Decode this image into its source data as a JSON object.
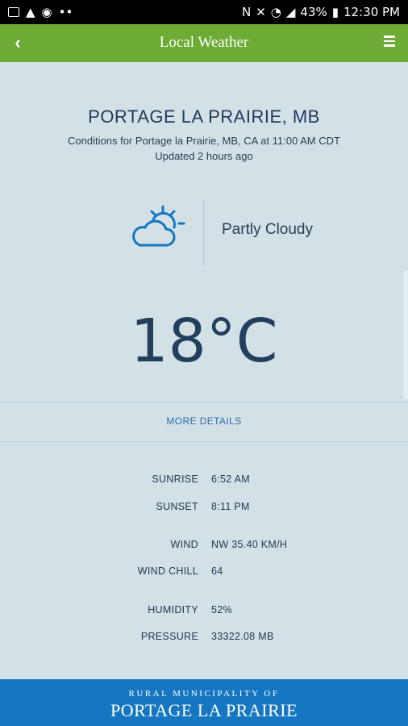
{
  "status_bar": {
    "battery": "43%",
    "time": "12:30 PM",
    "left_icons": [
      "image-icon",
      "drive-icon",
      "sync-icon",
      "more-icon"
    ],
    "right_icons": [
      "nfc-icon",
      "mute-icon",
      "wifi-icon",
      "signal-icon",
      "battery-icon"
    ]
  },
  "app_bar": {
    "title": "Local Weather",
    "color": "#6cab34"
  },
  "location": {
    "name": "PORTAGE LA PRAIRIE, MB",
    "conditions_for": "Conditions for Portage la Prairie, MB, CA at 11:00 AM CDT",
    "updated": "Updated 2 hours ago"
  },
  "current": {
    "icon": "partly-cloudy-icon",
    "condition": "Partly Cloudy",
    "temperature": "18°C"
  },
  "more_details_label": "MORE DETAILS",
  "details": [
    {
      "label": "SUNRISE",
      "value": "6:52 AM"
    },
    {
      "label": "SUNSET",
      "value": "8:11 PM"
    },
    {
      "label": "WIND",
      "value": "NW 35.40 KM/H"
    },
    {
      "label": "WIND CHILL",
      "value": "64"
    },
    {
      "label": "HUMIDITY",
      "value": "52%"
    },
    {
      "label": "PRESSURE",
      "value": "33322.08 MB"
    }
  ],
  "footer": {
    "top": "RURAL MUNICIPALITY OF",
    "main": "PORTAGE LA PRAIRIE",
    "color": "#1577c1"
  }
}
